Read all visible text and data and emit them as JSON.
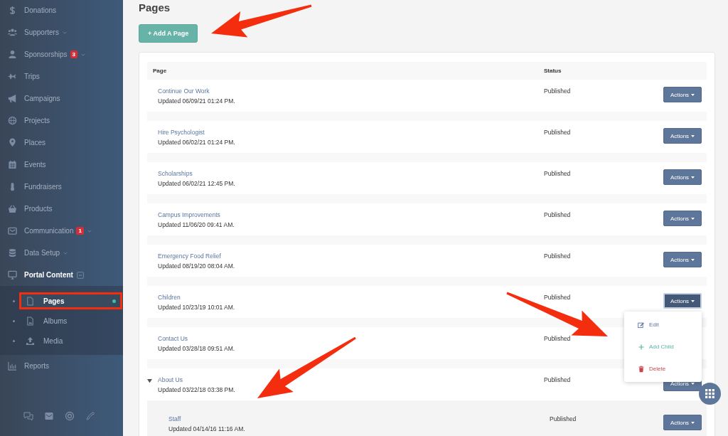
{
  "sidebar": {
    "items": [
      {
        "label": "Donations",
        "selected": false
      },
      {
        "label": "Supporters",
        "selected": false,
        "expanded": false
      },
      {
        "label": "Sponsorships",
        "selected": false,
        "badge": "3",
        "expanded": false
      },
      {
        "label": "Trips",
        "selected": false
      },
      {
        "label": "Campaigns",
        "selected": false
      },
      {
        "label": "Projects",
        "selected": false
      },
      {
        "label": "Places",
        "selected": false
      },
      {
        "label": "Events",
        "selected": false
      },
      {
        "label": "Fundraisers",
        "selected": false
      },
      {
        "label": "Products",
        "selected": false
      },
      {
        "label": "Communication",
        "selected": false,
        "badge": "1",
        "expanded": false
      },
      {
        "label": "Data Setup",
        "selected": false,
        "expanded": false
      },
      {
        "label": "Portal Content",
        "selected": true,
        "expanded": true,
        "children": [
          {
            "label": "Pages",
            "selected": true,
            "highlighted": true
          },
          {
            "label": "Albums",
            "selected": false,
            "highlighted": false
          },
          {
            "label": "Media",
            "selected": false,
            "highlighted": false
          }
        ]
      },
      {
        "label": "Reports",
        "selected": false
      }
    ]
  },
  "page": {
    "title": "Pages",
    "add_button": "+ Add A Page"
  },
  "table": {
    "columns": [
      "Page",
      "Status"
    ],
    "rows": [
      {
        "title": "Continue Our Work",
        "updated": "Updated 06/09/21 01:24 PM.",
        "status": "Published",
        "action": "Actions",
        "menu_open": false
      },
      {
        "title": "Hire Psychologist",
        "updated": "Updated 06/02/21 01:24 PM.",
        "status": "Published",
        "action": "Actions",
        "menu_open": false
      },
      {
        "title": "Scholarships",
        "updated": "Updated 06/02/21 12:45 PM.",
        "status": "Published",
        "action": "Actions",
        "menu_open": false
      },
      {
        "title": "Campus Improvements",
        "updated": "Updated 11/06/20 09:41 AM.",
        "status": "Published",
        "action": "Actions",
        "menu_open": false
      },
      {
        "title": "Emergency Food Relief",
        "updated": "Updated 08/19/20 08:04 AM.",
        "status": "Published",
        "action": "Actions",
        "menu_open": false
      },
      {
        "title": "Children",
        "updated": "Updated 10/23/19 10:01 AM.",
        "status": "Published",
        "action": "Actions",
        "menu_open": true,
        "menu": [
          {
            "kind": "edit",
            "label": "Edit"
          },
          {
            "kind": "add",
            "label": "Add Child"
          },
          {
            "kind": "delete",
            "label": "Delete"
          }
        ]
      },
      {
        "title": "Contact Us",
        "updated": "Updated 03/28/18 09:51 AM.",
        "status": "Published"
      },
      {
        "title": "About Us",
        "updated": "Updated 03/22/18 03:38 PM.",
        "status": "Published",
        "action": "Actions",
        "menu_open": false,
        "expanded": true,
        "children": [
          {
            "title": "Staff",
            "updated": "Updated 04/14/16 11:16 AM.",
            "status": "Published",
            "action": "Actions",
            "menu_open": false
          }
        ]
      }
    ]
  },
  "annotations": [
    {
      "kind": "arrow"
    },
    {
      "kind": "arrow"
    },
    {
      "kind": "arrow"
    }
  ]
}
